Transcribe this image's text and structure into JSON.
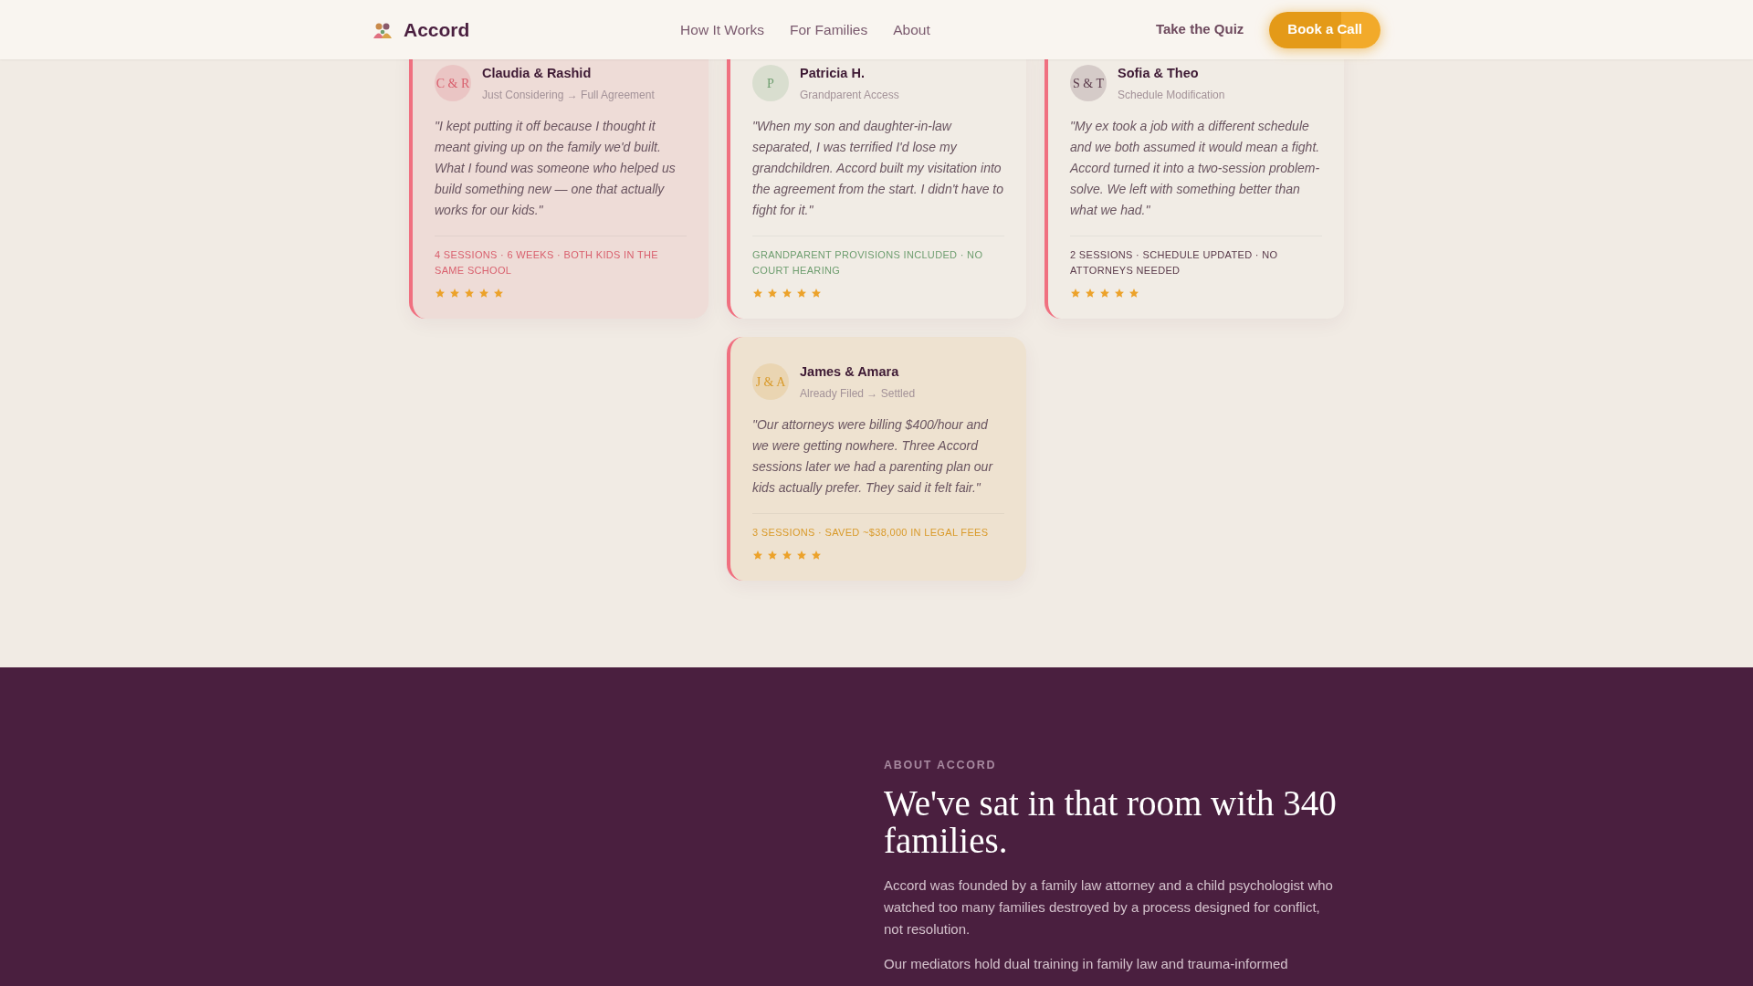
{
  "header": {
    "brand": "Accord",
    "nav": [
      {
        "label": "How It Works"
      },
      {
        "label": "For Families"
      },
      {
        "label": "About"
      }
    ],
    "quiz_link": "Take the Quiz",
    "cta": "Book a Call"
  },
  "testimonials": [
    {
      "initials": "C & R",
      "name": "Claudia & Rashid",
      "journey": "Just Considering → Full Agreement",
      "quote": "\"I kept putting it off because I thought it meant giving up on the family we'd built. What I found was someone who helped us build something new — one that actually works for our kids.\"",
      "outcome": "4 SESSIONS · 6 WEEKS · BOTH KIDS IN THE SAME SCHOOL",
      "color": "#d9606e",
      "tinted": true,
      "stars": 5
    },
    {
      "initials": "P",
      "name": "Patricia H.",
      "journey": "Grandparent Access",
      "quote": "\"When my son and daughter-in-law separated, I was terrified I'd lose my grandchildren. Accord built my visitation into the agreement from the start. I didn't have to fight for it.\"",
      "outcome": "GRANDPARENT PROVISIONS INCLUDED · NO COURT HEARING",
      "color": "#6f9e70",
      "tinted": false,
      "stars": 5
    },
    {
      "initials": "S & T",
      "name": "Sofia & Theo",
      "journey": "Schedule Modification",
      "quote": "\"My ex took a job with a different schedule and we both assumed it would mean a fight. Accord turned it into a two-session problem-solve. We left with something better than what we had.\"",
      "outcome": "2 SESSIONS · SCHEDULE UPDATED · NO ATTORNEYS NEEDED",
      "color": "#5a3a4a",
      "tinted": false,
      "stars": 5
    },
    {
      "initials": "J & A",
      "name": "James & Amara",
      "journey": "Already Filed → Settled",
      "quote": "\"Our attorneys were billing $400/hour and we were getting nowhere. Three Accord sessions later we had a parenting plan our kids actually prefer. They said it felt fair.\"",
      "outcome": "3 SESSIONS · SAVED ~$38,000 IN LEGAL FEES",
      "color": "#d99a2a",
      "tinted": true,
      "stars": 5
    }
  ],
  "about": {
    "eyebrow": "ABOUT ACCORD",
    "heading": "We've sat in that room with 340 families.",
    "paragraphs": [
      "Accord was founded by a family law attorney and a child psychologist who watched too many families destroyed by a process designed for conflict, not resolution.",
      "Our mediators hold dual training in family law and trauma-informed"
    ]
  }
}
